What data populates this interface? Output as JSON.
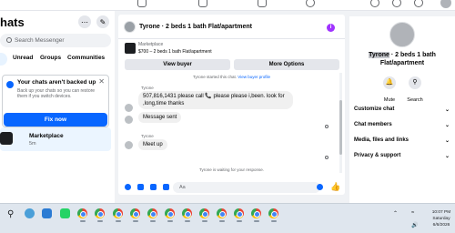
{
  "left_panel": {
    "title": "hats",
    "search_placeholder": "Search Messenger",
    "filters": [
      "Unread",
      "Groups",
      "Communities"
    ],
    "backup": {
      "title": "Your chats aren't backed up",
      "text": "Back up your chats so you can restore them if you switch devices.",
      "button": "Fix now"
    },
    "conversation": {
      "name": "Marketplace",
      "time": "5m"
    }
  },
  "chat": {
    "title": "Tyrone · 2 beds 1 bath Flat/apartment",
    "listing": {
      "label": "Marketplace",
      "price": "$700 – 2 beds 1 bath Flat/apartment",
      "view_buyer": "View buyer",
      "more_options": "More Options"
    },
    "system_started": "Tyrone started this chat.",
    "view_profile": "View buyer profile",
    "messages": [
      {
        "sender": "Tyrone",
        "text": "507,816,1431 please call 📞 please please i,been. look for ,long,time thanks"
      },
      {
        "sender": "",
        "text": "Message sent"
      },
      {
        "sender": "Tyrone",
        "text": "Meet up"
      }
    ],
    "waiting": "Tyrone is waiting for your response.",
    "input_placeholder": "Aa"
  },
  "right_panel": {
    "title_highlight": "Tyrone",
    "title_rest": " · 2 beds 1 bath Flat/apartment",
    "actions": [
      {
        "icon": "bell-icon",
        "label": "Mute"
      },
      {
        "icon": "search-icon",
        "label": "Search"
      }
    ],
    "sections": [
      "Customize chat",
      "Chat members",
      "Media, files and links",
      "Privacy & support"
    ]
  },
  "taskbar": {
    "time": "10:07 PM",
    "day": "Saturday",
    "date": "6/6/2026"
  },
  "colors": {
    "accent": "#0866ff",
    "info": "#a033ff",
    "selected": "#ebf5ff"
  }
}
